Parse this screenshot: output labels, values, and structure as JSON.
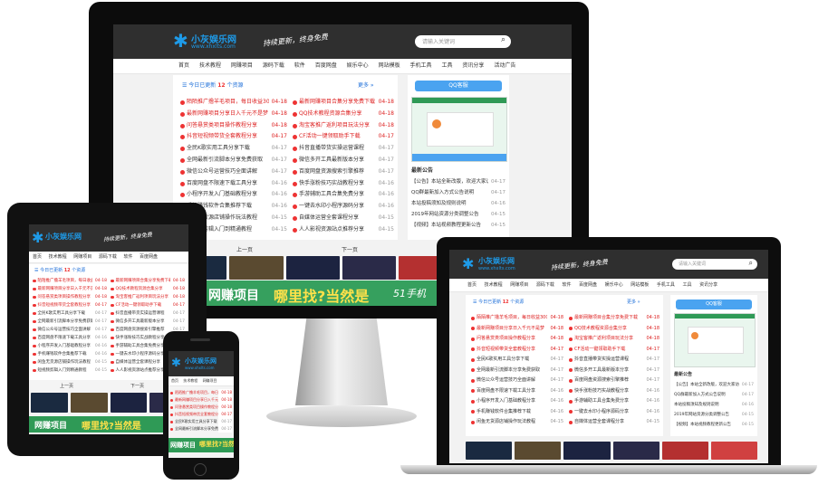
{
  "site": {
    "logo_text": "小灰娱乐网",
    "logo_sub": "www.xhxlts.com",
    "slogan": "持续更新，终身免费",
    "search_placeholder": "请输入关键词",
    "search_icon": "magnifier-icon",
    "nav_items": [
      "首页",
      "技术教程",
      "网赚项目",
      "源码下载",
      "软件",
      "百度网盘",
      "娱乐中心",
      "网站模板",
      "手机工具",
      "工具",
      "资讯分享",
      "活动广告"
    ],
    "panel_title_prefix": "今日已更新",
    "panel_title_count": "12",
    "panel_title_suffix": "个资源",
    "more_label": "更多 »",
    "qq_button": "QQ客服",
    "notice_title": "最新公告",
    "pager_prev": "上一页",
    "pager_next": "下一页",
    "banner_part1": "网赚项目",
    "banner_part2": "哪里找?当然是",
    "banner_part3": "51手机",
    "left_items": [
      {
        "title": "陌陌推广撸羊毛项目，每日收益300元以上！",
        "date": "04-18",
        "red": true
      },
      {
        "title": "最新网赚项目分享日入千元不是梦",
        "date": "04-18",
        "red": true
      },
      {
        "title": "问答悬赏类项目操作教程分享",
        "date": "04-18",
        "red": true
      },
      {
        "title": "抖音短视频带货全套教程分享",
        "date": "04-17",
        "red": true
      },
      {
        "title": "全民K歌实用工具分享下载",
        "date": "04-17",
        "red": false
      },
      {
        "title": "全网最新引流脚本分享免费获取",
        "date": "04-17",
        "red": false
      },
      {
        "title": "微信公众号运营技巧全面讲解",
        "date": "04-17",
        "red": false
      },
      {
        "title": "百度网盘不限速下载工具分享",
        "date": "04-16",
        "red": false
      },
      {
        "title": "小程序开发入门基础教程分享",
        "date": "04-16",
        "red": false
      },
      {
        "title": "手机赚钱软件合集推荐下载",
        "date": "04-16",
        "red": false
      },
      {
        "title": "闲鱼无货源店铺操作玩法教程",
        "date": "04-15",
        "red": false
      },
      {
        "title": "短视频剪辑入门到精通教程",
        "date": "04-15",
        "red": false
      }
    ],
    "right_items": [
      {
        "title": "最新网赚项目合集分享免费下载",
        "date": "04-18",
        "red": true
      },
      {
        "title": "QQ技术教程资源合集分享",
        "date": "04-18",
        "red": true
      },
      {
        "title": "淘宝客推广返利项目玩法分享",
        "date": "04-18",
        "red": true
      },
      {
        "title": "CF活动一键领取助手下载",
        "date": "04-17",
        "red": true
      },
      {
        "title": "抖音直播带货实操运营课程",
        "date": "04-17",
        "red": false
      },
      {
        "title": "微信多开工具最新版本分享",
        "date": "04-17",
        "red": false
      },
      {
        "title": "百度网盘资源搜索引擎推荐",
        "date": "04-17",
        "red": false
      },
      {
        "title": "快手涨粉技巧实战教程分享",
        "date": "04-16",
        "red": false
      },
      {
        "title": "手游辅助工具合集免费分享",
        "date": "04-16",
        "red": false
      },
      {
        "title": "一键去水印小程序源码分享",
        "date": "04-16",
        "red": false
      },
      {
        "title": "自媒体运营全套课程分享",
        "date": "04-15",
        "red": false
      },
      {
        "title": "人人影视资源站点推荐分享",
        "date": "04-15",
        "red": false
      }
    ],
    "notice_items": [
      {
        "title": "【公告】本站全新改版，欢迎大家访问",
        "date": "04-17"
      },
      {
        "title": "QQ群最新加入方式公告说明",
        "date": "04-17"
      },
      {
        "title": "本站投稿须知及规则说明",
        "date": "04-16"
      },
      {
        "title": "2019年网站资源分类调整公告",
        "date": "04-15"
      },
      {
        "title": "【视频】本站视频教程更新公告",
        "date": "04-15"
      }
    ]
  }
}
